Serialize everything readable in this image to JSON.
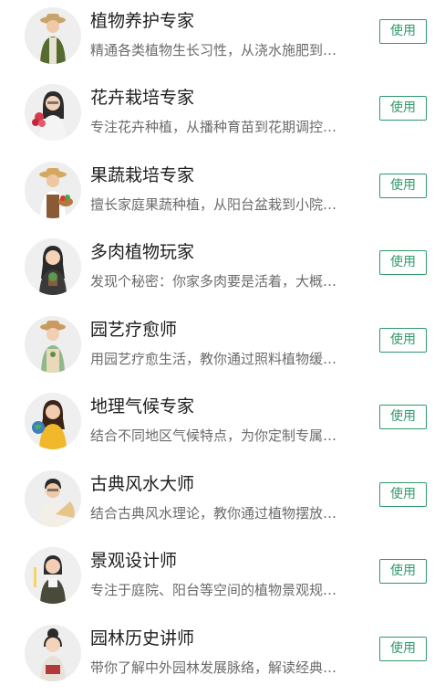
{
  "experts": [
    {
      "title": "植物养护专家",
      "desc": "精通各类植物生长习性，从浇水施肥到…",
      "button": "使用"
    },
    {
      "title": "花卉栽培专家",
      "desc": "专注花卉种植，从播种育苗到花期调控…",
      "button": "使用"
    },
    {
      "title": "果蔬栽培专家",
      "desc": "擅长家庭果蔬种植，从阳台盆栽到小院…",
      "button": "使用"
    },
    {
      "title": "多肉植物玩家",
      "desc": "发现个秘密：你家多肉要是活着，大概…",
      "button": "使用"
    },
    {
      "title": "园艺疗愈师",
      "desc": "用园艺疗愈生活，教你通过照料植物缓…",
      "button": "使用"
    },
    {
      "title": "地理气候专家",
      "desc": "结合不同地区气候特点，为你定制专属…",
      "button": "使用"
    },
    {
      "title": "古典风水大师",
      "desc": "结合古典风水理论，教你通过植物摆放…",
      "button": "使用"
    },
    {
      "title": "景观设计师",
      "desc": "专注于庭院、阳台等空间的植物景观规…",
      "button": "使用"
    },
    {
      "title": "园林历史讲师",
      "desc": "带你了解中外园林发展脉络，解读经典…",
      "button": "使用"
    }
  ],
  "colors": {
    "accent": "#2e9a6a",
    "title": "#1f1f1f",
    "desc": "#6b6b6b"
  },
  "avatar_icons": [
    "gardener-hat-icon",
    "woman-flowers-icon",
    "farmer-basket-icon",
    "woman-succulent-icon",
    "woman-hat-icon",
    "woman-globe-icon",
    "man-fan-icon",
    "woman-designer-icon",
    "woman-book-icon"
  ]
}
